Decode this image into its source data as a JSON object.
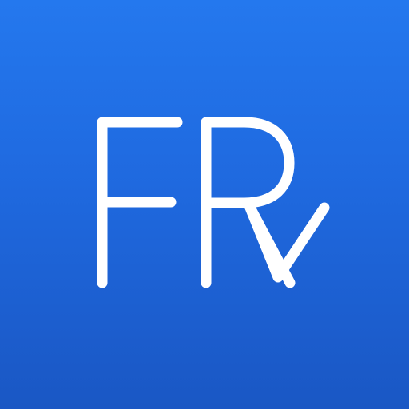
{
  "app_icon": {
    "logo_text": "FRv",
    "colors": {
      "background_top": "#2478ee",
      "background_bottom": "#1a57c4",
      "foreground": "#ffffff"
    }
  }
}
